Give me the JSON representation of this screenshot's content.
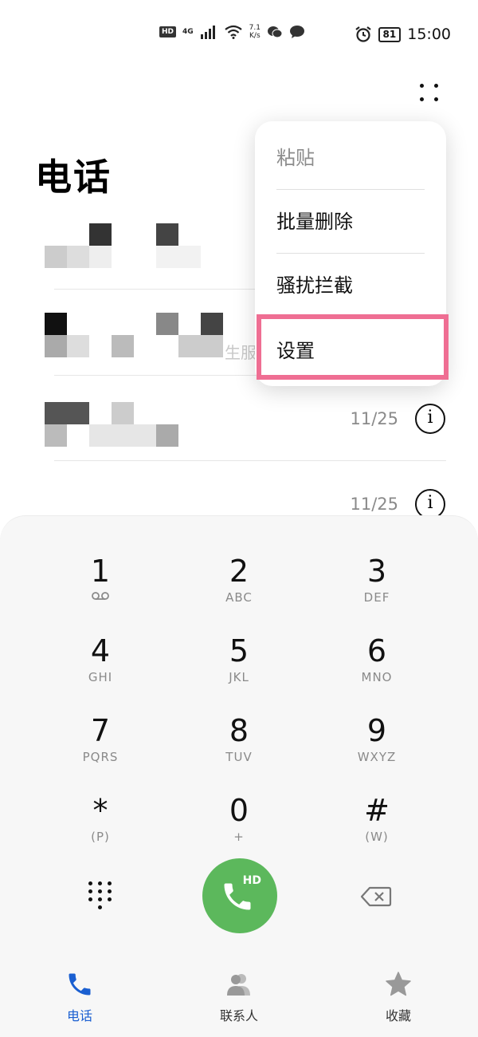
{
  "status_bar": {
    "hd": "HD",
    "network": "4G",
    "speed_value": "7.1",
    "speed_unit": "K/s",
    "battery": "81",
    "time": "15:00"
  },
  "title": "电话",
  "calls": [
    {
      "date": "",
      "partial_label": "生服"
    },
    {
      "date": "11/25",
      "partial_label": ""
    },
    {
      "date": "11/25",
      "partial_label": ""
    }
  ],
  "menu": {
    "items": [
      {
        "label": "粘贴",
        "enabled": false
      },
      {
        "label": "批量删除",
        "enabled": true
      },
      {
        "label": "骚扰拦截",
        "enabled": true
      },
      {
        "label": "设置",
        "enabled": true
      }
    ]
  },
  "dialpad": {
    "keys": [
      {
        "num": "1",
        "sub": ""
      },
      {
        "num": "2",
        "sub": "ABC"
      },
      {
        "num": "3",
        "sub": "DEF"
      },
      {
        "num": "4",
        "sub": "GHI"
      },
      {
        "num": "5",
        "sub": "JKL"
      },
      {
        "num": "6",
        "sub": "MNO"
      },
      {
        "num": "7",
        "sub": "PQRS"
      },
      {
        "num": "8",
        "sub": "TUV"
      },
      {
        "num": "9",
        "sub": "WXYZ"
      },
      {
        "num": "*",
        "sub": "(P)"
      },
      {
        "num": "0",
        "sub": "+"
      },
      {
        "num": "#",
        "sub": "(W)"
      }
    ],
    "call_badge": "HD"
  },
  "tabs": [
    {
      "label": "电话",
      "icon": "phone-icon",
      "active": true
    },
    {
      "label": "联系人",
      "icon": "contacts-icon",
      "active": false
    },
    {
      "label": "收藏",
      "icon": "star-icon",
      "active": false
    }
  ],
  "colors": {
    "accent": "#1a5fd1",
    "call_green": "#5cb85c",
    "highlight": "#ef6e93"
  }
}
